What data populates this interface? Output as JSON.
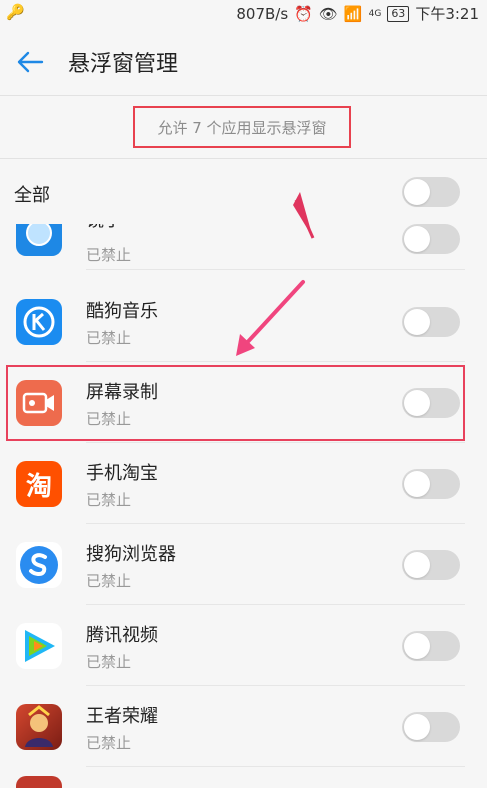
{
  "status_bar": {
    "speed": "807B/s",
    "network": "4G",
    "battery": "63",
    "time": "下午3:21"
  },
  "header": {
    "title": "悬浮窗管理"
  },
  "subtitle": "允许 7 个应用显示悬浮窗",
  "all_label": "全部",
  "apps": [
    {
      "name": "镜子",
      "status": "已禁止",
      "icon": "mirror-icon",
      "color": "#1e88e5"
    },
    {
      "name": "酷狗音乐",
      "status": "已禁止",
      "icon": "kugou-icon",
      "color": "#1b8cf0"
    },
    {
      "name": "屏幕录制",
      "status": "已禁止",
      "icon": "screen-record-icon",
      "color": "#ee6b4d"
    },
    {
      "name": "手机淘宝",
      "status": "已禁止",
      "icon": "taobao-icon",
      "color": "#ff5000"
    },
    {
      "name": "搜狗浏览器",
      "status": "已禁止",
      "icon": "sogou-browser-icon",
      "color": "#2a8cf0"
    },
    {
      "name": "腾讯视频",
      "status": "已禁止",
      "icon": "tencent-video-icon",
      "color": "#20b7f5"
    },
    {
      "name": "王者荣耀",
      "status": "已禁止",
      "icon": "honor-of-kings-icon",
      "color": "#c0392b"
    }
  ],
  "colors": {
    "accent": "#1e88e5",
    "annotation": "#e8414f",
    "arrow": "#f0457e"
  }
}
